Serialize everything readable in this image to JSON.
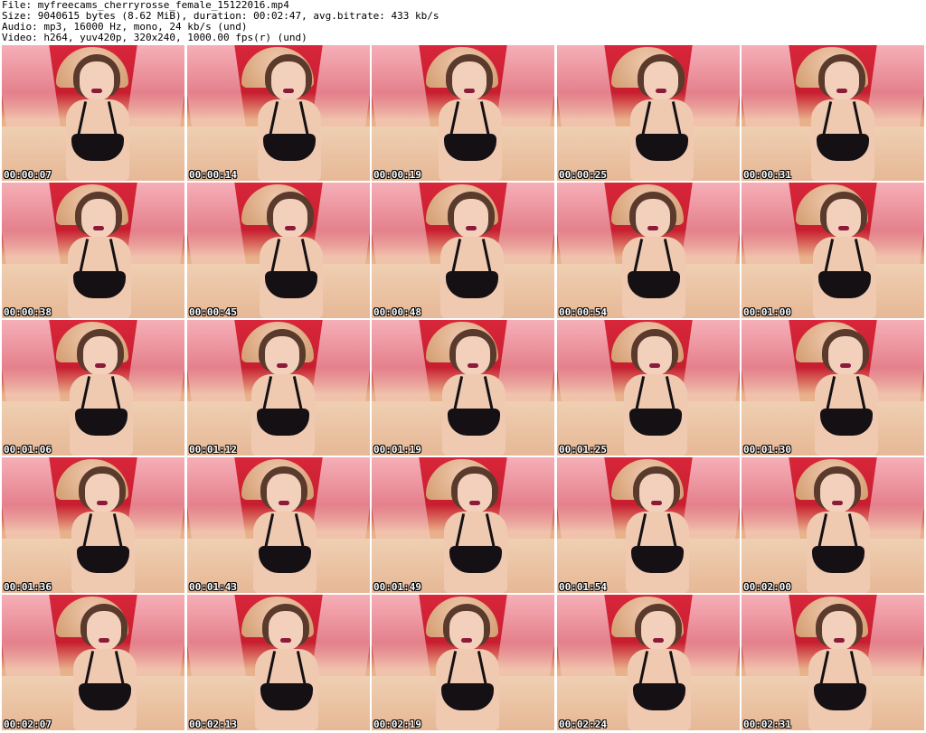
{
  "header": {
    "file": "File: myfreecams_cherryrosse_female_15122016.mp4",
    "size": "Size: 9040615 bytes (8.62 MiB), duration: 00:02:47, avg.bitrate: 433 kb/s",
    "audio": "Audio: mp3, 16000 Hz, mono, 24 kb/s (und)",
    "video": "Video: h264, yuv420p, 320x240, 1000.00 fps(r) (und)"
  },
  "thumbnails": [
    {
      "timestamp": "00:00:07"
    },
    {
      "timestamp": "00:00:14"
    },
    {
      "timestamp": "00:00:19"
    },
    {
      "timestamp": "00:00:25"
    },
    {
      "timestamp": "00:00:31"
    },
    {
      "timestamp": "00:00:38"
    },
    {
      "timestamp": "00:00:45"
    },
    {
      "timestamp": "00:00:48"
    },
    {
      "timestamp": "00:00:54"
    },
    {
      "timestamp": "00:01:00"
    },
    {
      "timestamp": "00:01:06"
    },
    {
      "timestamp": "00:01:12"
    },
    {
      "timestamp": "00:01:19"
    },
    {
      "timestamp": "00:01:25"
    },
    {
      "timestamp": "00:01:30"
    },
    {
      "timestamp": "00:01:36"
    },
    {
      "timestamp": "00:01:43"
    },
    {
      "timestamp": "00:01:49"
    },
    {
      "timestamp": "00:01:54"
    },
    {
      "timestamp": "00:02:00"
    },
    {
      "timestamp": "00:02:07"
    },
    {
      "timestamp": "00:02:13"
    },
    {
      "timestamp": "00:02:19"
    },
    {
      "timestamp": "00:02:24"
    },
    {
      "timestamp": "00:02:31"
    }
  ]
}
